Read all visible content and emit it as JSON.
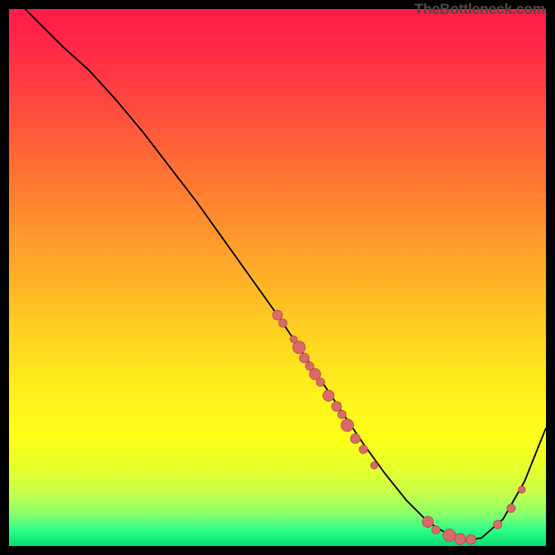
{
  "watermark": "TheBottleneck.com",
  "chart_data": {
    "type": "line",
    "title": "",
    "xlabel": "",
    "ylabel": "",
    "xlim": [
      0,
      100
    ],
    "ylim": [
      0,
      100
    ],
    "series": [
      {
        "name": "curve",
        "x": [
          3,
          6,
          10,
          15,
          20,
          25,
          30,
          35,
          40,
          45,
          50,
          54,
          58,
          62,
          66,
          70,
          74,
          78,
          82,
          85,
          88,
          92,
          96,
          100
        ],
        "y": [
          100,
          97,
          93,
          88.5,
          83,
          77,
          70.5,
          64,
          57,
          50,
          43,
          37,
          31,
          25,
          19,
          13.5,
          8.5,
          4.5,
          2,
          1,
          1.5,
          5,
          12,
          22
        ]
      }
    ],
    "points": [
      {
        "x": 50,
        "y": 43,
        "r": 7
      },
      {
        "x": 51,
        "y": 41.5,
        "r": 6
      },
      {
        "x": 53,
        "y": 38.5,
        "r": 5
      },
      {
        "x": 54,
        "y": 37,
        "r": 9
      },
      {
        "x": 55,
        "y": 35,
        "r": 7
      },
      {
        "x": 56,
        "y": 33.5,
        "r": 6
      },
      {
        "x": 57,
        "y": 32,
        "r": 8
      },
      {
        "x": 58,
        "y": 30.5,
        "r": 6
      },
      {
        "x": 59.5,
        "y": 28,
        "r": 8
      },
      {
        "x": 61,
        "y": 26,
        "r": 7
      },
      {
        "x": 62,
        "y": 24.5,
        "r": 6
      },
      {
        "x": 63,
        "y": 22.5,
        "r": 9
      },
      {
        "x": 64.5,
        "y": 20,
        "r": 7
      },
      {
        "x": 66,
        "y": 18,
        "r": 6
      },
      {
        "x": 68,
        "y": 15,
        "r": 5
      },
      {
        "x": 78,
        "y": 4.5,
        "r": 8
      },
      {
        "x": 79.5,
        "y": 3,
        "r": 6
      },
      {
        "x": 82,
        "y": 2,
        "r": 9
      },
      {
        "x": 84,
        "y": 1.3,
        "r": 8
      },
      {
        "x": 86,
        "y": 1.2,
        "r": 7
      },
      {
        "x": 91,
        "y": 4,
        "r": 6
      },
      {
        "x": 93.5,
        "y": 7,
        "r": 6
      },
      {
        "x": 95.5,
        "y": 10.5,
        "r": 5
      }
    ]
  }
}
